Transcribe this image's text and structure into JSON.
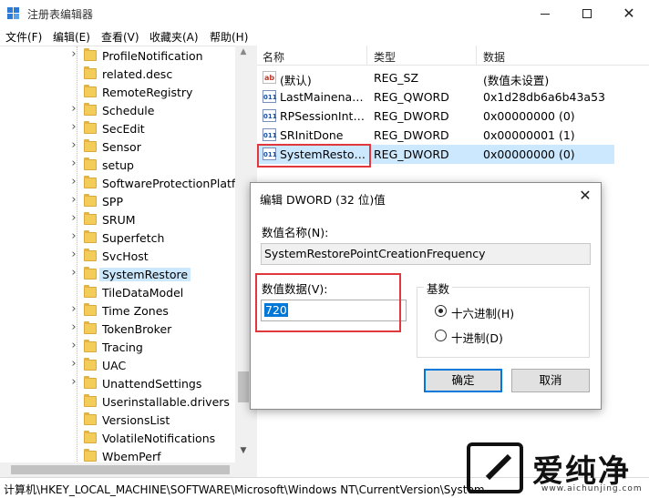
{
  "window": {
    "title": "注册表编辑器",
    "controls": {
      "minimize": "—",
      "maximize": "",
      "close": "✕"
    }
  },
  "menu": [
    "文件(F)",
    "编辑(E)",
    "查看(V)",
    "收藏夹(A)",
    "帮助(H)"
  ],
  "tree": {
    "items": [
      {
        "label": "ProfileNotification",
        "expandable": true,
        "selected": false
      },
      {
        "label": "related.desc",
        "expandable": false,
        "selected": false
      },
      {
        "label": "RemoteRegistry",
        "expandable": false,
        "selected": false
      },
      {
        "label": "Schedule",
        "expandable": true,
        "selected": false
      },
      {
        "label": "SecEdit",
        "expandable": true,
        "selected": false
      },
      {
        "label": "Sensor",
        "expandable": true,
        "selected": false
      },
      {
        "label": "setup",
        "expandable": true,
        "selected": false
      },
      {
        "label": "SoftwareProtectionPlatfor",
        "expandable": true,
        "selected": false
      },
      {
        "label": "SPP",
        "expandable": true,
        "selected": false
      },
      {
        "label": "SRUM",
        "expandable": true,
        "selected": false
      },
      {
        "label": "Superfetch",
        "expandable": true,
        "selected": false
      },
      {
        "label": "SvcHost",
        "expandable": true,
        "selected": false
      },
      {
        "label": "SystemRestore",
        "expandable": true,
        "selected": true
      },
      {
        "label": "TileDataModel",
        "expandable": false,
        "selected": false
      },
      {
        "label": "Time Zones",
        "expandable": true,
        "selected": false
      },
      {
        "label": "TokenBroker",
        "expandable": true,
        "selected": false
      },
      {
        "label": "Tracing",
        "expandable": true,
        "selected": false
      },
      {
        "label": "UAC",
        "expandable": true,
        "selected": false
      },
      {
        "label": "UnattendSettings",
        "expandable": true,
        "selected": false
      },
      {
        "label": "Userinstallable.drivers",
        "expandable": false,
        "selected": false
      },
      {
        "label": "VersionsList",
        "expandable": false,
        "selected": false
      },
      {
        "label": "VolatileNotifications",
        "expandable": false,
        "selected": false
      },
      {
        "label": "WbemPerf",
        "expandable": false,
        "selected": false
      }
    ]
  },
  "list": {
    "columns": [
      "名称",
      "类型",
      "数据"
    ],
    "rows": [
      {
        "icon": "string-value-icon",
        "badge": "ab",
        "name": "(默认)",
        "type": "REG_SZ",
        "data": "(数值未设置)",
        "selected": false
      },
      {
        "icon": "binary-value-icon",
        "badge": "011",
        "name": "LastMainenanceTime",
        "type": "REG_QWORD",
        "data": "0x1d28db6a6b43a53",
        "selected": false
      },
      {
        "icon": "binary-value-icon",
        "badge": "011",
        "name": "RPSessionInterval",
        "type": "REG_DWORD",
        "data": "0x00000000 (0)",
        "selected": false
      },
      {
        "icon": "binary-value-icon",
        "badge": "011",
        "name": "SRInitDone",
        "type": "REG_DWORD",
        "data": "0x00000001 (1)",
        "selected": false
      },
      {
        "icon": "binary-value-icon",
        "badge": "011",
        "name": "SystemRestorePointCreationFrequency",
        "type": "REG_DWORD",
        "data": "0x00000000 (0)",
        "selected": true
      }
    ]
  },
  "statusbar": "计算机\\HKEY_LOCAL_MACHINE\\SOFTWARE\\Microsoft\\Windows NT\\CurrentVersion\\System",
  "dialog": {
    "title": "编辑 DWORD (32 位)值",
    "close": "✕",
    "name_label": "数值名称(N):",
    "name_value": "SystemRestorePointCreationFrequency",
    "data_label": "数值数据(V):",
    "data_value": "720",
    "base_label": "基数",
    "radio_hex": "十六进制(H)",
    "radio_dec": "十进制(D)",
    "base_selected": "hex",
    "ok": "确定",
    "cancel": "取消"
  },
  "watermark": {
    "text": "爱纯净",
    "url": "www.aichunjing.com"
  },
  "colors": {
    "selection": "#cce8ff",
    "highlight_box": "#e0383d",
    "accent": "#0078d7",
    "folder": "#f4cc5a"
  }
}
